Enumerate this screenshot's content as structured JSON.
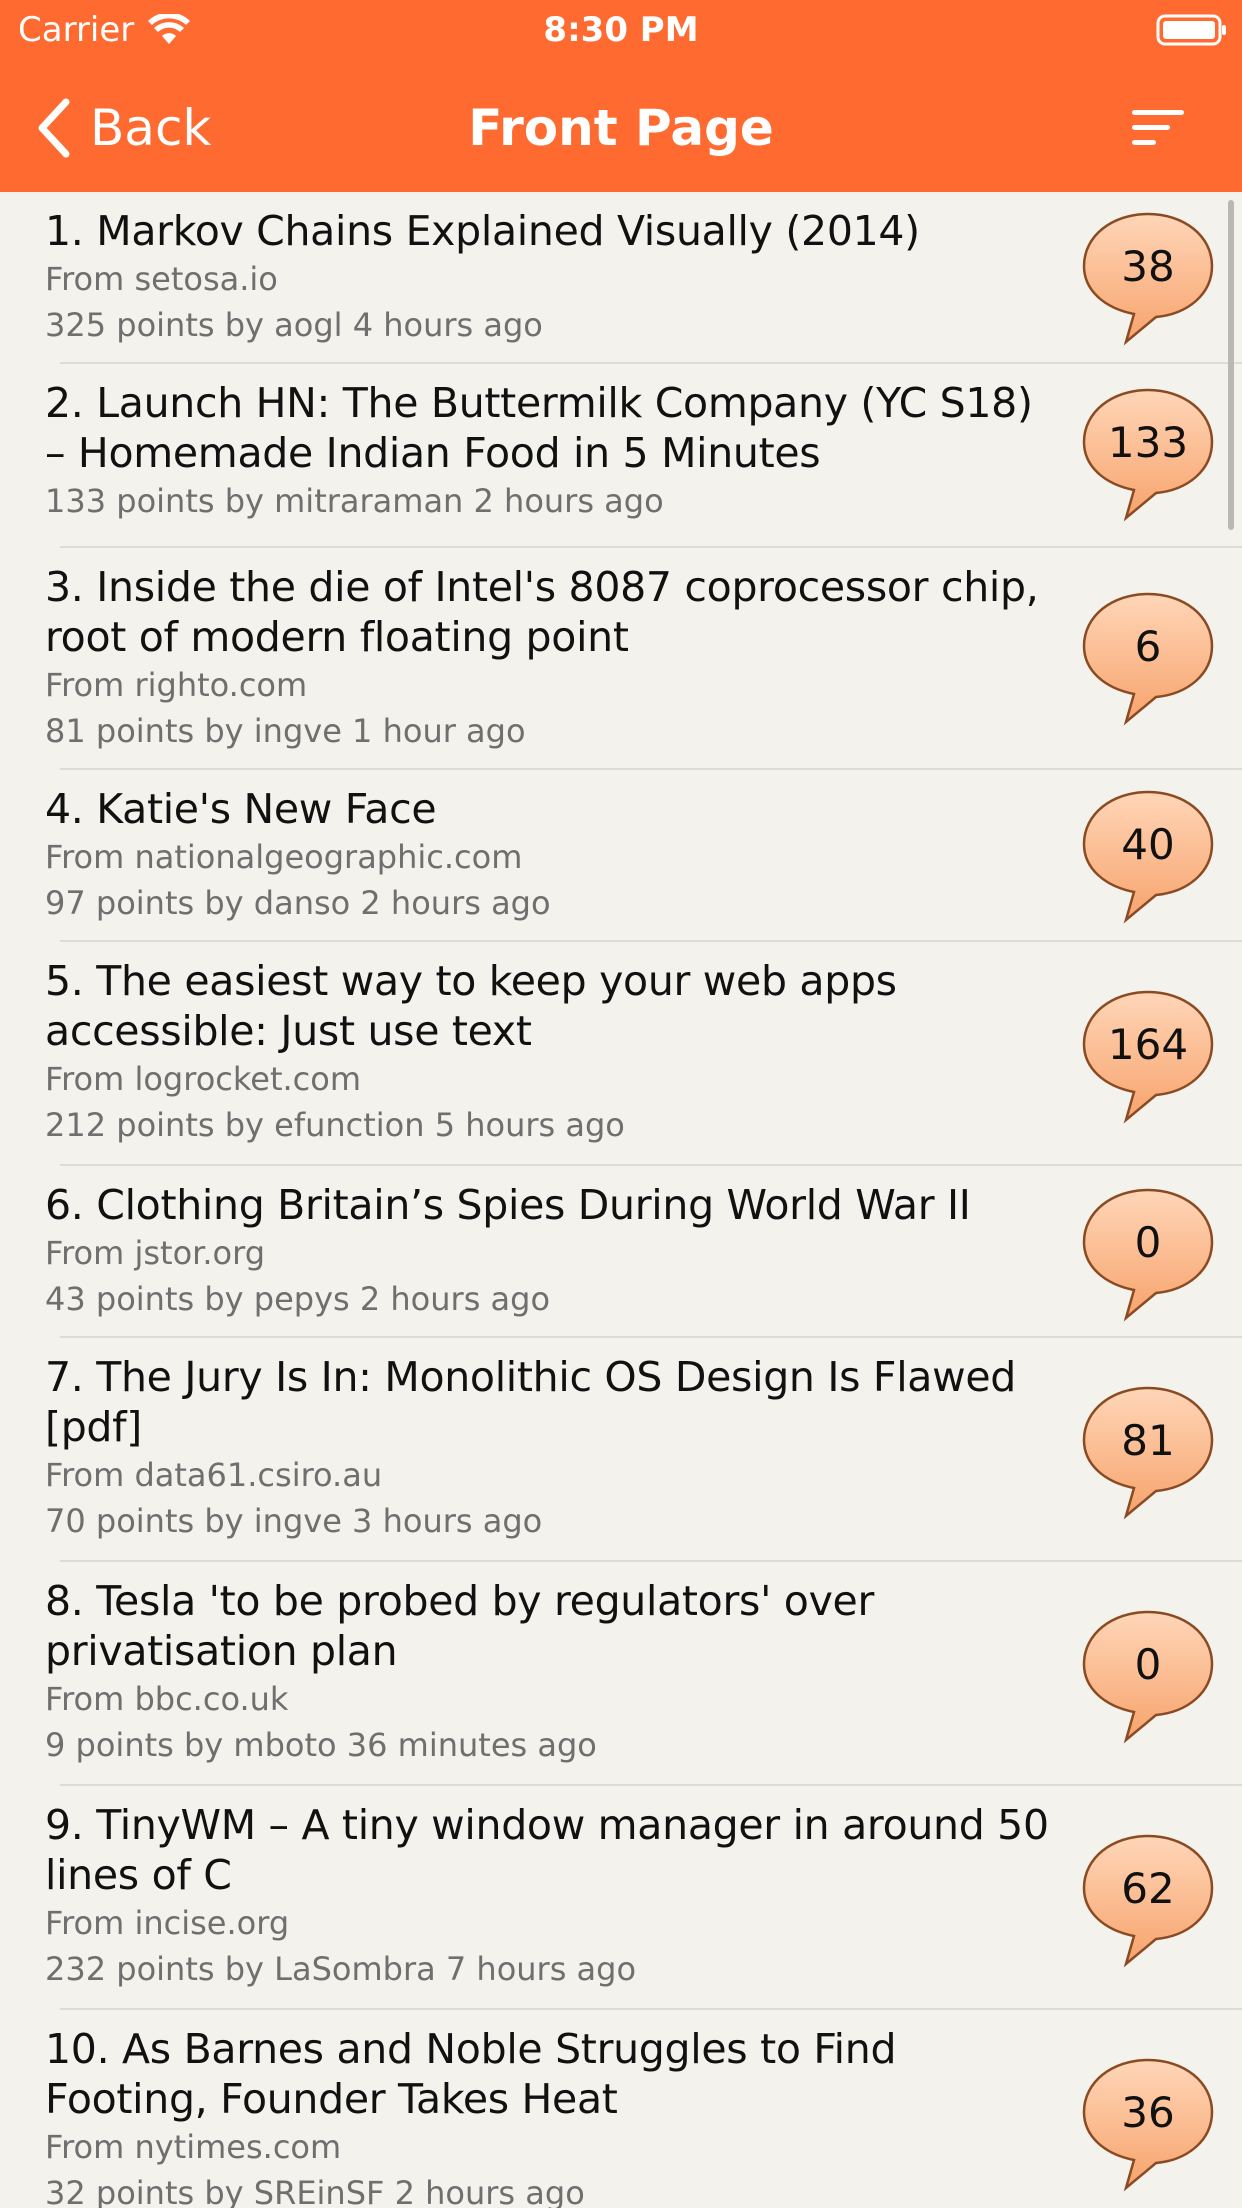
{
  "status_bar": {
    "carrier": "Carrier",
    "time": "8:30 PM"
  },
  "nav": {
    "back_label": "Back",
    "title": "Front Page",
    "sort_icon": "sort-lines-icon"
  },
  "colors": {
    "header": "#ff6a30",
    "background": "#f3f2ec",
    "bubble_fill_top": "#ffd6b8",
    "bubble_fill_bottom": "#f7a36c",
    "bubble_stroke": "#8a4a22"
  },
  "stories": [
    {
      "title": "1. Markov Chains Explained Visually (2014)",
      "source": "From setosa.io",
      "meta": "325 points by aogl 4 hours ago",
      "comments": "38"
    },
    {
      "title": "2. Launch HN: The Buttermilk  Company (YC S18) – Homemade Indian Food in 5 Minutes",
      "source": "",
      "meta": "133 points by mitraraman 2 hours ago",
      "comments": "133"
    },
    {
      "title": "3. Inside the die of Intel's 8087 coprocessor chip, root of modern floating point",
      "source": "From righto.com",
      "meta": "81 points by ingve 1 hour ago",
      "comments": "6"
    },
    {
      "title": "4. Katie's New Face",
      "source": "From nationalgeographic.com",
      "meta": "97 points by danso 2 hours ago",
      "comments": "40"
    },
    {
      "title": "5. The easiest way to keep your web apps accessible: Just use text",
      "source": "From logrocket.com",
      "meta": "212 points by efunction 5 hours ago",
      "comments": "164"
    },
    {
      "title": "6. Clothing Britain’s Spies During World War II",
      "source": "From jstor.org",
      "meta": "43 points by pepys 2 hours ago",
      "comments": "0"
    },
    {
      "title": "7. The Jury Is In: Monolithic OS Design Is Flawed [pdf]",
      "source": "From data61.csiro.au",
      "meta": "70 points by ingve 3 hours ago",
      "comments": "81"
    },
    {
      "title": "8. Tesla 'to be probed by regulators' over privatisation plan",
      "source": "From bbc.co.uk",
      "meta": "9 points by mboto 36 minutes ago",
      "comments": "0"
    },
    {
      "title": "9. TinyWM – A tiny window manager in around 50 lines of C",
      "source": "From incise.org",
      "meta": "232 points by LaSombra 7 hours ago",
      "comments": "62"
    },
    {
      "title": "10. As Barnes and Noble Struggles to Find Footing, Founder Takes Heat",
      "source": "From nytimes.com",
      "meta": "32 points by SREinSF 2 hours ago",
      "comments": "36"
    }
  ]
}
